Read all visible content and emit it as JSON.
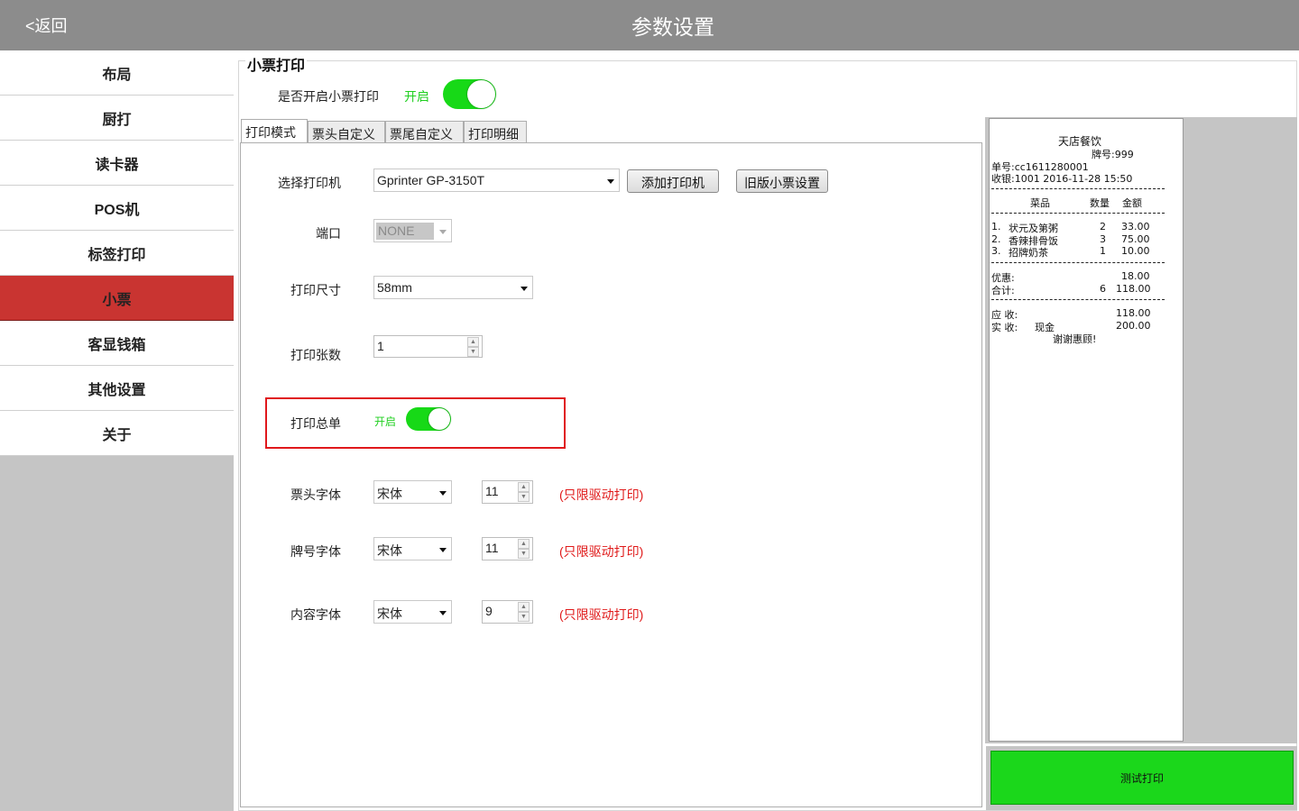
{
  "header": {
    "back_label": "<返回",
    "title": "参数设置"
  },
  "sidebar": {
    "items": [
      {
        "label": "布局"
      },
      {
        "label": "厨打"
      },
      {
        "label": "读卡器"
      },
      {
        "label": "POS机"
      },
      {
        "label": "标签打印"
      },
      {
        "label": "小票",
        "active": true
      },
      {
        "label": "客显钱箱"
      },
      {
        "label": "其他设置"
      },
      {
        "label": "关于"
      }
    ]
  },
  "main": {
    "group_title": "小票打印",
    "enable_receipt": {
      "label": "是否开启小票打印",
      "state_label": "开启",
      "on": true
    },
    "tabs": [
      {
        "label": "打印模式",
        "active": true
      },
      {
        "label": "票头自定义"
      },
      {
        "label": "票尾自定义"
      },
      {
        "label": "打印明细"
      }
    ],
    "form": {
      "printer": {
        "label": "选择打印机",
        "value": "Gprinter  GP-3150T",
        "add_button": "添加打印机",
        "legacy_button": "旧版小票设置"
      },
      "port": {
        "label": "端口",
        "value": "NONE",
        "disabled": true
      },
      "size": {
        "label": "打印尺寸",
        "value": "58mm"
      },
      "copies": {
        "label": "打印张数",
        "value": "1"
      },
      "summary": {
        "label": "打印总单",
        "state_label": "开启",
        "on": true
      },
      "header_font": {
        "label": "票头字体",
        "font": "宋体",
        "size": "11",
        "note": "(只限驱动打印)"
      },
      "number_font": {
        "label": "牌号字体",
        "font": "宋体",
        "size": "11",
        "note": "(只限驱动打印)"
      },
      "content_font": {
        "label": "内容字体",
        "font": "宋体",
        "size": "9",
        "note": "(只限驱动打印)"
      }
    }
  },
  "receipt": {
    "shop_name": "天店餐饮",
    "plate_no": "牌号:999",
    "order_no": "单号:cc1611280001",
    "cashier": "收银:1001  2016-11-28 15:50",
    "col_item": "菜品",
    "col_qty": "数量",
    "col_amount": "金额",
    "items": [
      {
        "idx": "1.",
        "name": "状元及第粥",
        "qty": "2",
        "amount": "33.00"
      },
      {
        "idx": "2.",
        "name": "香辣排骨饭",
        "qty": "3",
        "amount": "75.00"
      },
      {
        "idx": "3.",
        "name": "招牌奶茶",
        "qty": "1",
        "amount": "10.00"
      }
    ],
    "discount_label": "优惠:",
    "discount_value": "18.00",
    "total_label": "合计:",
    "total_qty": "6",
    "total_value": "118.00",
    "due_label": "应  收:",
    "due_value": "118.00",
    "paid_label": "实  收:",
    "paid_method": "现金",
    "paid_value": "200.00",
    "thanks": "谢谢惠顾!"
  },
  "test_print_label": "测试打印",
  "colors": {
    "titlebar": "#8c8c8c",
    "active_sidebar": "#c93431",
    "toggle_on": "#17d917",
    "note_red": "#e01a1a",
    "highlight": "#e0181c"
  }
}
